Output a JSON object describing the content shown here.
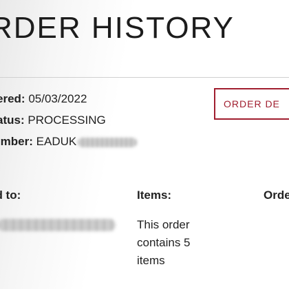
{
  "page": {
    "title": "RDER HISTORY"
  },
  "order": {
    "ordered_label": "rdered:",
    "ordered_value": "05/03/2022",
    "status_label": "Status:",
    "status_value": "PROCESSING",
    "number_label": "Number:",
    "number_value": "EADUK"
  },
  "actions": {
    "details_label": "ORDER DE"
  },
  "columns": {
    "shipped_label": "ed to:",
    "items_label": "Items:",
    "order_label": "Orde"
  },
  "items": {
    "summary": "This order contains 5 items"
  },
  "colors": {
    "accent": "#a01d2e",
    "text": "#1a1a1a",
    "divider": "#d0d0d0"
  }
}
